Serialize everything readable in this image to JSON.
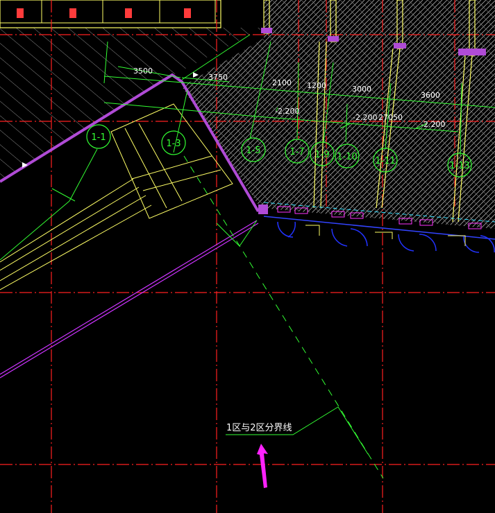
{
  "colors": {
    "background": "#000000",
    "grid_axis": "#ff2020",
    "wall_outline": "#ffff66",
    "dimension_line": "#33ff33",
    "boundary": "#cc33ff",
    "door_swing": "#2233ff",
    "hatch": "#ffffff",
    "arrow": "#ff22ff",
    "dashed_split": "#33ff33"
  },
  "dimensions": {
    "d1": "3500",
    "d2": "3750",
    "d3": "2100",
    "d4": "1200",
    "d5": "3000",
    "d6": "3600"
  },
  "levels": {
    "l1": "-2.200",
    "l2": "-2.200",
    "l3": "27050",
    "l4": "-2.200"
  },
  "axis_bubbles": [
    "1-1",
    "1-3",
    "1-5",
    "1-7",
    "1-9",
    "1-10",
    "1-11",
    "1-13"
  ],
  "note": {
    "text": "1区与2区分界线"
  },
  "icons": {
    "arrow": "arrow-pointer-icon"
  }
}
